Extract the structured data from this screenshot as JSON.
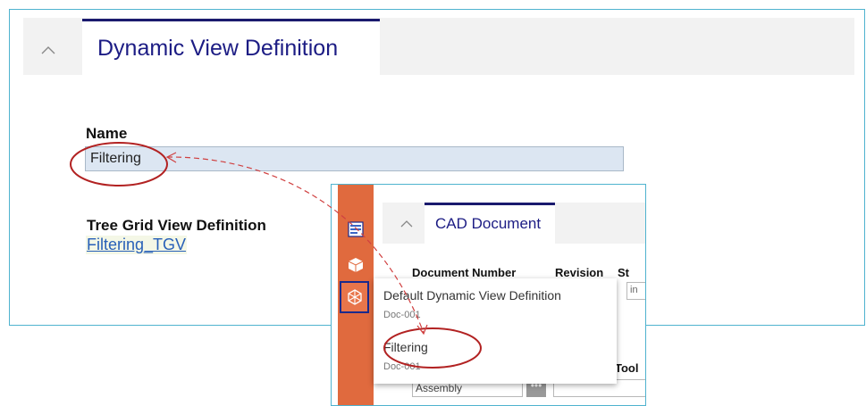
{
  "main": {
    "tab_title": "Dynamic View Definition",
    "name_label": "Name",
    "name_value": "Filtering",
    "tgv_label": "Tree Grid View Definition",
    "tgv_link": "Filtering_TGV"
  },
  "overlay": {
    "tab_title": "CAD Document",
    "columns": {
      "document_number": "Document Number",
      "revision": "Revision",
      "state": "St"
    },
    "state_value": "in",
    "tool_label": "Tool",
    "assembly_value": "Assembly",
    "ellipsis": "•••",
    "toolbar_icons": [
      "form-icon",
      "cube-icon",
      "structure-icon"
    ],
    "toolbar_color": "#e06a3e"
  },
  "menu": {
    "items": [
      {
        "title": "Default Dynamic View Definition",
        "subtitle": "Doc-001"
      },
      {
        "title": "Filtering",
        "subtitle": "Doc-001"
      }
    ]
  },
  "colors": {
    "accent": "#1c1c84",
    "border": "#4fb3cf",
    "annotation": "#b22222"
  }
}
